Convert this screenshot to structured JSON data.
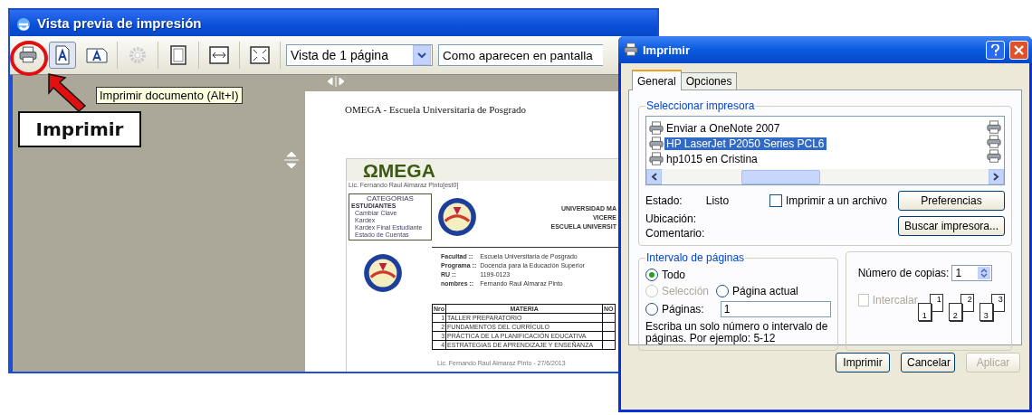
{
  "preview_window": {
    "title": "Vista previa de impresión",
    "toolbar": [
      {
        "kind": "print",
        "disabled": false
      },
      {
        "kind": "portrait",
        "disabled": false
      },
      {
        "kind": "landscape",
        "disabled": false
      },
      {
        "kind": "gear",
        "disabled": true
      },
      {
        "kind": "page",
        "disabled": false
      },
      {
        "kind": "width",
        "disabled": false
      },
      {
        "kind": "fullpage",
        "disabled": false
      }
    ],
    "view_select": "Vista de 1 página",
    "scale_select": "Como aparecen en pantalla",
    "tooltip": "Imprimir documento (Alt+I)",
    "document": {
      "header": "OMEGA - Escuela Universitaria de Posgrado",
      "logo": "ΩMEGA",
      "user": "Lic. Fernando Raul Almaraz Pinto[est0]",
      "categories": {
        "title": "CATEGORIAS",
        "group": "ESTUDIANTES",
        "items": [
          "Cambiar Clave",
          "Kardex",
          "Kardex Final Estudiante",
          "Estado de Cuentas"
        ]
      },
      "university_lines": [
        "UNIVERSIDAD MA",
        "VICERE",
        "ESCUELA UNIVERSIT"
      ],
      "fields": [
        {
          "label": "Facultad ::",
          "value": "Escuela Universitaria de Posgrado"
        },
        {
          "label": "Programa ::",
          "value": "Docencia para la Educación Superior"
        },
        {
          "label": "RU ::",
          "value": "1199-0123"
        },
        {
          "label": "nombres ::",
          "value": "Fernando Raul Almaraz Pinto"
        }
      ],
      "table": {
        "columns": [
          "Nro",
          "MATERIA",
          "NO"
        ],
        "rows": [
          [
            "1",
            "TALLER PREPARATORIO"
          ],
          [
            "2",
            "FUNDAMENTOS DEL CURRÍCULO"
          ],
          [
            "3",
            "PRÁCTICA DE LA PLANIFICACIÓN EDUCATIVA"
          ],
          [
            "4",
            "ESTRATEGIAS DE APRENDIZAJE Y ENSEÑANZA"
          ]
        ]
      },
      "footer": "Lic. Fernando Raul Almaraz Pinto - 27/6/2013"
    }
  },
  "callout": {
    "label": "Imprimir"
  },
  "print_dialog": {
    "title": "Imprimir",
    "tabs": [
      {
        "label": "General",
        "selected": true
      },
      {
        "label": "Opciones",
        "selected": false
      }
    ],
    "printer_group": "Seleccionar impresora",
    "printers": [
      {
        "name": "Enviar a OneNote 2007",
        "selected": false
      },
      {
        "name": "HP LaserJet P2050 Series PCL6",
        "selected": true
      },
      {
        "name": "hp1015 en Cristina",
        "selected": false
      }
    ],
    "status_label": "Estado:",
    "status_value": "Listo",
    "location_label": "Ubicación:",
    "comment_label": "Comentario:",
    "print_to_file": {
      "label": "Imprimir a un archivo",
      "checked": false,
      "disabled": false
    },
    "preferences_button": "Preferencias",
    "find_button": "Buscar impresora...",
    "range_group": "Intervalo de páginas",
    "range_options": [
      {
        "label": "Todo",
        "selected": true,
        "disabled": false
      },
      {
        "label": "Selección",
        "selected": false,
        "disabled": true
      },
      {
        "label": "Página actual",
        "selected": false,
        "disabled": false
      },
      {
        "label": "Páginas:",
        "selected": false,
        "disabled": false
      }
    ],
    "pages_value": "1",
    "range_hint": "Escriba un solo número o intervalo de páginas. Por ejemplo: 5-12",
    "copies_label": "Número de copias:",
    "copies_value": "1",
    "collate": {
      "label": "Intercalar",
      "checked": false,
      "disabled": true
    },
    "collate_pages": [
      [
        "1",
        "1"
      ],
      [
        "2",
        "2"
      ],
      [
        "3",
        "3"
      ]
    ],
    "buttons": [
      {
        "label": "Imprimir",
        "disabled": false
      },
      {
        "label": "Cancelar",
        "disabled": false
      },
      {
        "label": "Aplicar",
        "disabled": true
      }
    ]
  }
}
